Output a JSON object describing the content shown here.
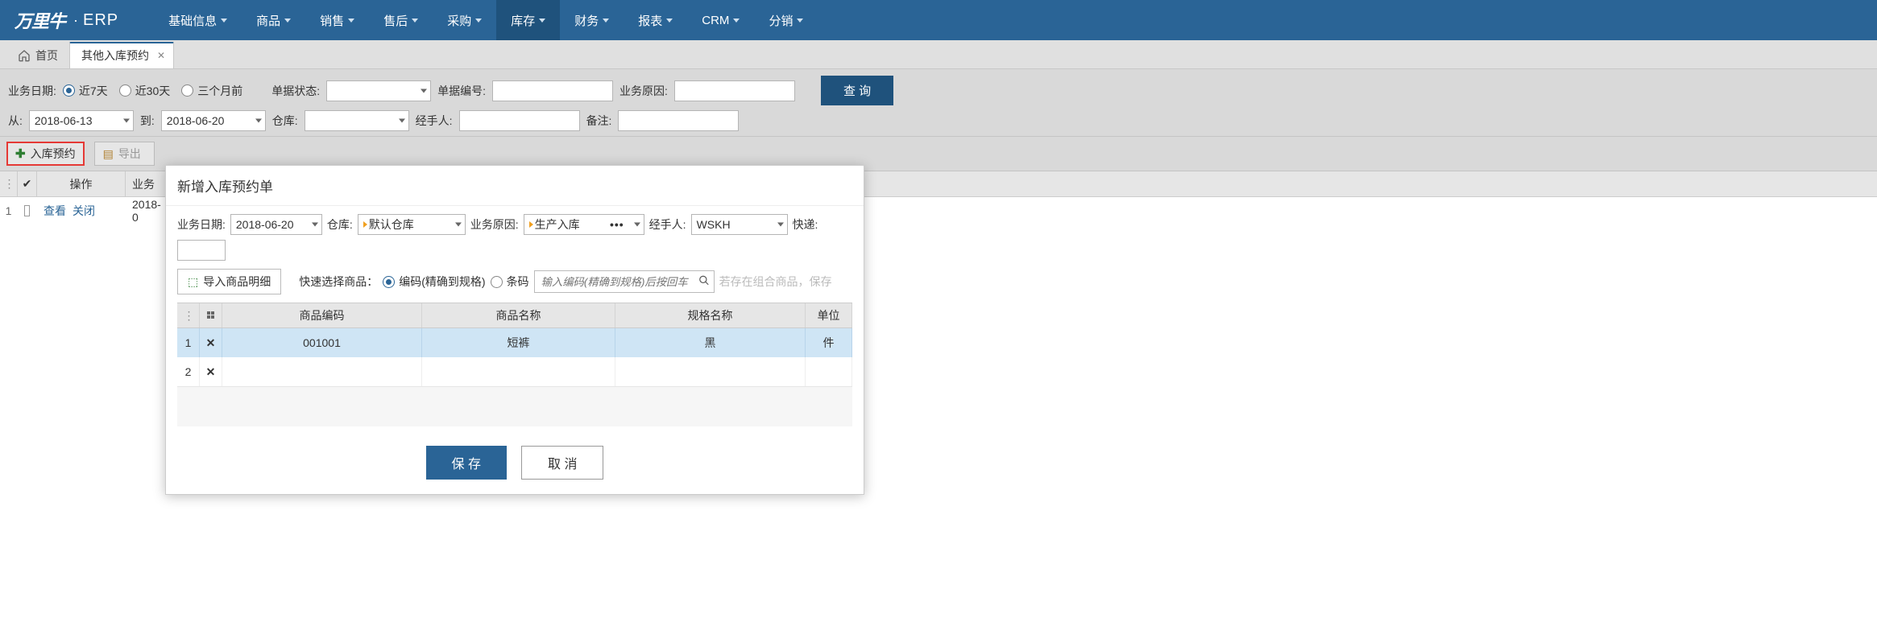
{
  "brand": {
    "logo_text": "万里牛",
    "dot": "·",
    "suffix": "ERP"
  },
  "nav": {
    "items": [
      {
        "label": "基础信息"
      },
      {
        "label": "商品"
      },
      {
        "label": "销售"
      },
      {
        "label": "售后"
      },
      {
        "label": "采购"
      },
      {
        "label": "库存",
        "active": true
      },
      {
        "label": "财务"
      },
      {
        "label": "报表"
      },
      {
        "label": "CRM"
      },
      {
        "label": "分销"
      }
    ]
  },
  "tabs": {
    "home": "首页",
    "current": "其他入库预约"
  },
  "filters": {
    "biz_date_label": "业务日期:",
    "ranges": [
      {
        "label": "近7天",
        "checked": true
      },
      {
        "label": "近30天",
        "checked": false
      },
      {
        "label": "三个月前",
        "checked": false
      }
    ],
    "status_label": "单据状态:",
    "billno_label": "单据编号:",
    "reason_label": "业务原因:",
    "from_label": "从:",
    "from_value": "2018-06-13",
    "to_label": "到:",
    "to_value": "2018-06-20",
    "warehouse_label": "仓库:",
    "handler_label": "经手人:",
    "remark_label": "备注:",
    "query_btn": "查 询"
  },
  "toolbar": {
    "reserve_btn": "入库预约",
    "export_btn": "导出"
  },
  "grid": {
    "col_op": "操作",
    "col_biz": "业务",
    "row_index": "1",
    "view": "查看",
    "close": "关闭",
    "biz_value": "2018-0"
  },
  "modal": {
    "title": "新增入库预约单",
    "biz_date_label": "业务日期:",
    "biz_date_value": "2018-06-20",
    "warehouse_label": "仓库:",
    "warehouse_value": "默认仓库",
    "reason_label": "业务原因:",
    "reason_value": "生产入库",
    "handler_label": "经手人:",
    "handler_value": "WSKH",
    "express_label": "快递:",
    "import_btn": "导入商品明细",
    "quick_label": "快速选择商品：",
    "mode_code": "编码(精确到规格)",
    "mode_barcode": "条码",
    "search_placeholder": "输入编码(精确到规格)后按回车",
    "hint": "若存在组合商品，保存",
    "cols": {
      "code": "商品编码",
      "name": "商品名称",
      "spec": "规格名称",
      "unit": "单位"
    },
    "rows": [
      {
        "idx": "1",
        "code": "001001",
        "name": "短裤",
        "spec": "黑",
        "unit": "件"
      },
      {
        "idx": "2",
        "code": "",
        "name": "",
        "spec": "",
        "unit": ""
      }
    ],
    "save": "保 存",
    "cancel": "取 消"
  }
}
